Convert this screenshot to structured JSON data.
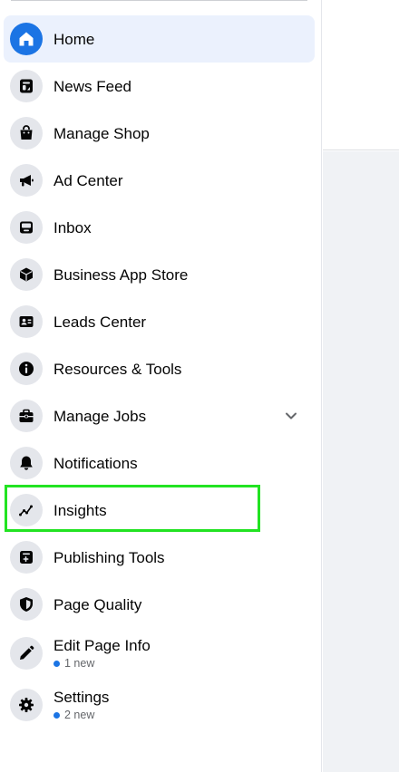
{
  "colors": {
    "accent": "#1b74e4",
    "active_bg": "#ebf1fd",
    "icon_bg": "#e4e6eb",
    "highlight": "#22e322",
    "badge_dot": "#1b74e4"
  },
  "nav": {
    "items": [
      {
        "label": "Home",
        "icon": "home-icon"
      },
      {
        "label": "News Feed",
        "icon": "news-feed-icon"
      },
      {
        "label": "Manage Shop",
        "icon": "shopping-bag-icon"
      },
      {
        "label": "Ad Center",
        "icon": "megaphone-icon"
      },
      {
        "label": "Inbox",
        "icon": "inbox-icon"
      },
      {
        "label": "Business App Store",
        "icon": "cube-icon"
      },
      {
        "label": "Leads Center",
        "icon": "contact-card-icon"
      },
      {
        "label": "Resources & Tools",
        "icon": "info-icon"
      },
      {
        "label": "Manage Jobs",
        "icon": "briefcase-icon"
      },
      {
        "label": "Notifications",
        "icon": "bell-icon"
      },
      {
        "label": "Insights",
        "icon": "insights-chart-icon"
      },
      {
        "label": "Publishing Tools",
        "icon": "publishing-tools-icon"
      },
      {
        "label": "Page Quality",
        "icon": "shield-icon"
      },
      {
        "label": "Edit Page Info",
        "icon": "pencil-icon",
        "badge": "1 new"
      },
      {
        "label": "Settings",
        "icon": "gear-icon",
        "badge": "2 new"
      }
    ]
  }
}
